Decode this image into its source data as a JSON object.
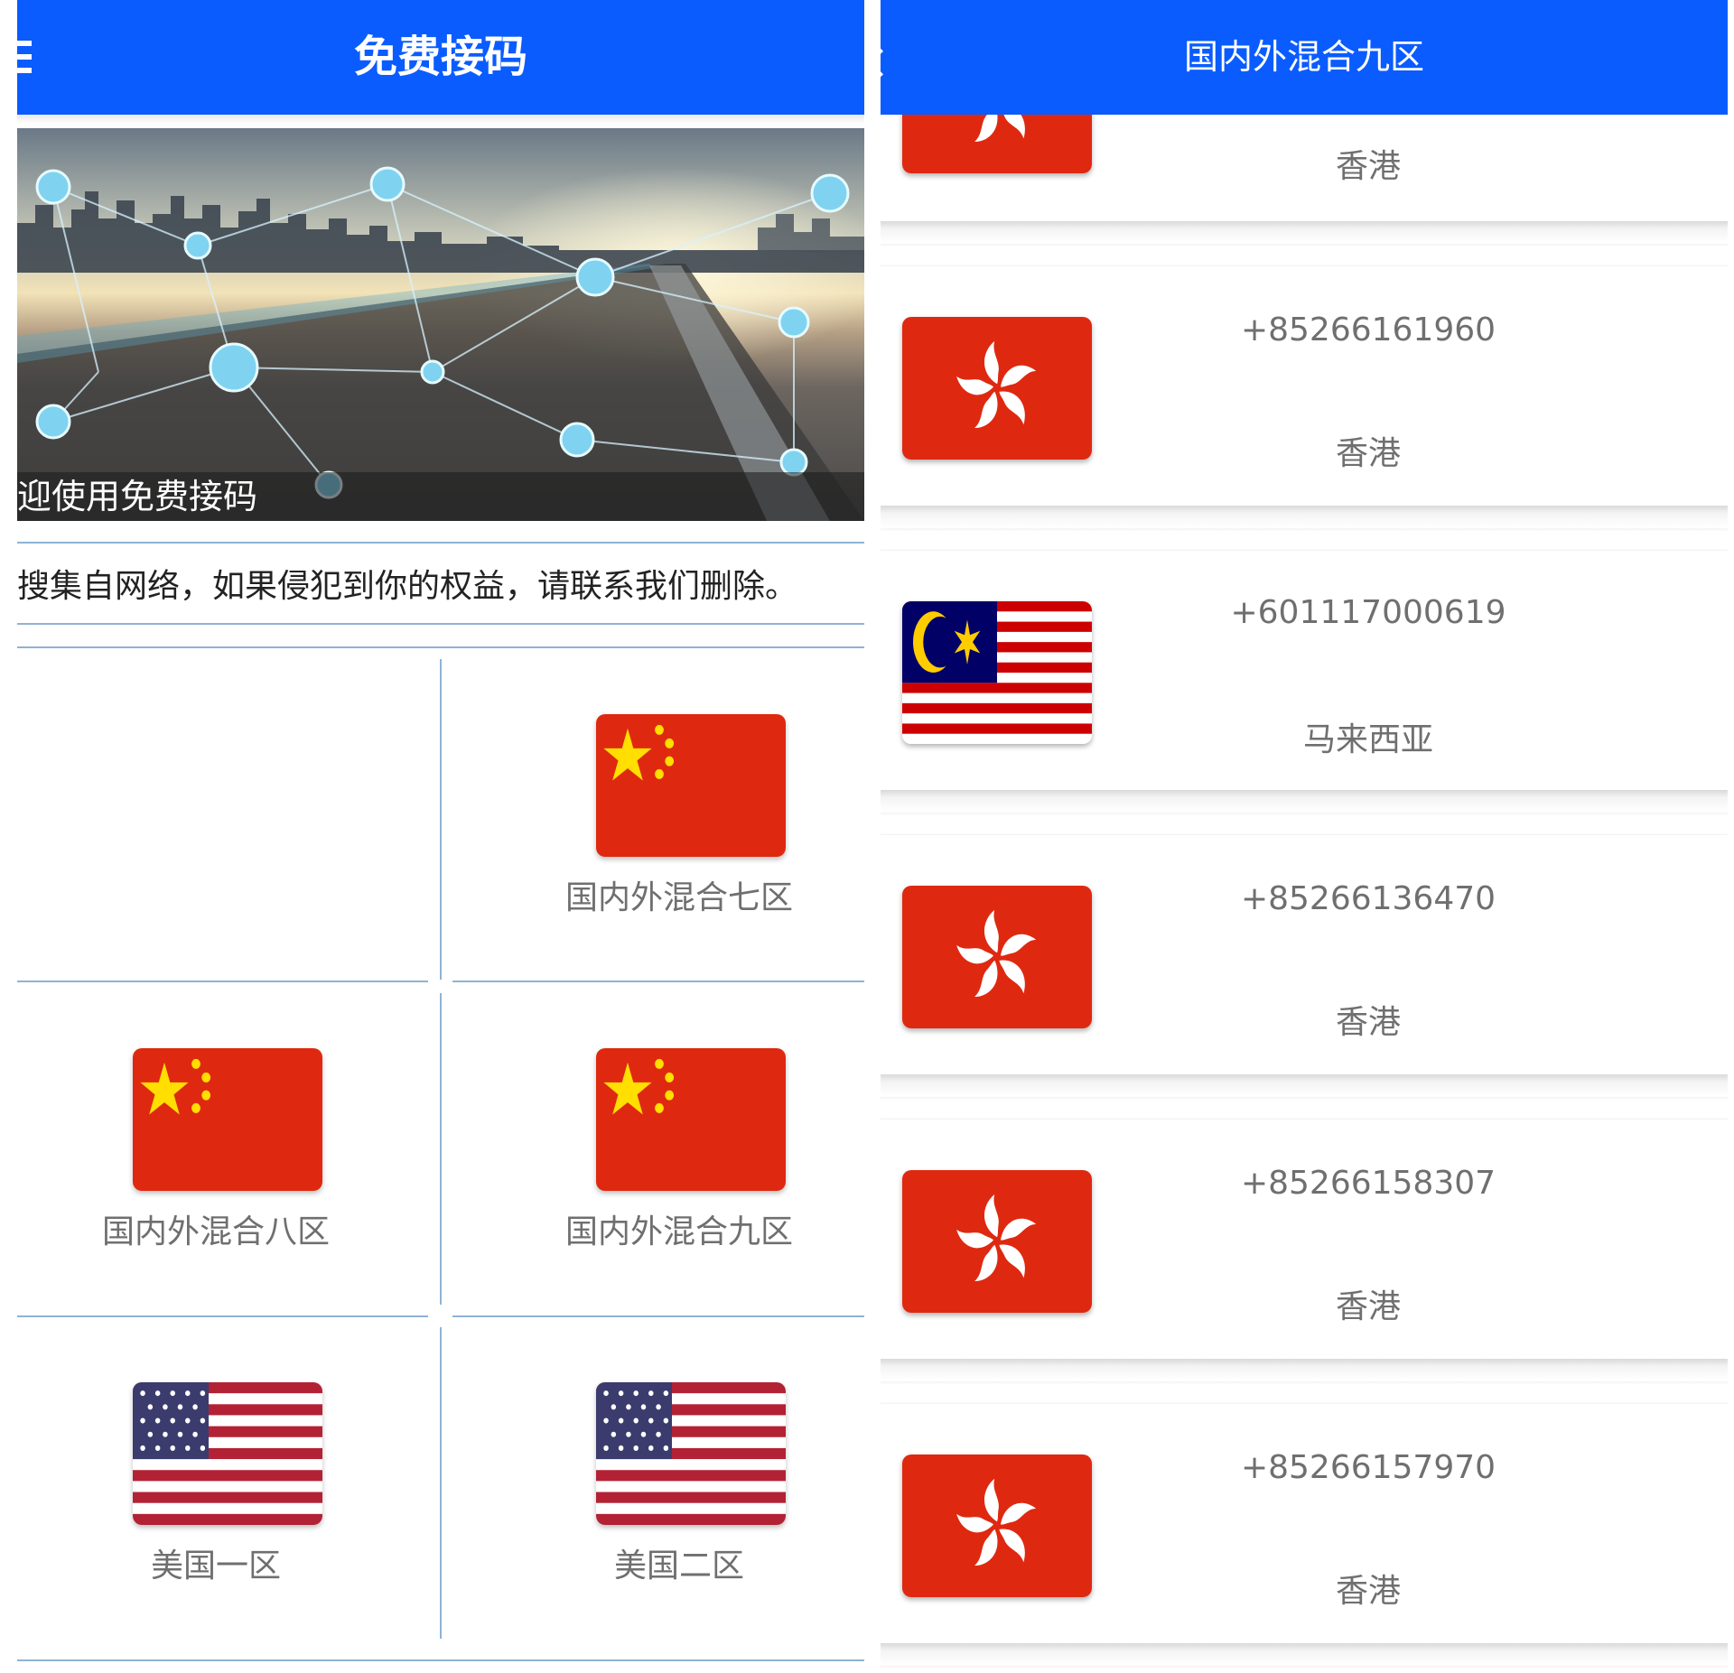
{
  "left_screen": {
    "app_bar": {
      "title": "免费接码",
      "menu_icon": "menu-icon"
    },
    "banner": {
      "caption": "迎使用免费接码"
    },
    "notice": "搜集自网络，如果侵犯到你的权益，请联系我们删除。",
    "grid": [
      {
        "label": "",
        "flag": "empty"
      },
      {
        "label": "国内外混合七区",
        "flag": "china-flag-icon"
      },
      {
        "label": "国内外混合八区",
        "flag": "china-flag-icon"
      },
      {
        "label": "国内外混合九区",
        "flag": "china-flag-icon"
      },
      {
        "label": "美国一区",
        "flag": "usa-flag-icon"
      },
      {
        "label": "美国二区",
        "flag": "usa-flag-icon"
      }
    ]
  },
  "right_screen": {
    "app_bar": {
      "title": "国内外混合九区",
      "back_icon": "back-arrow-icon"
    },
    "numbers": [
      {
        "phone": "",
        "region": "香港",
        "flag": "hong-kong-flag-icon"
      },
      {
        "phone": "+85266161960",
        "region": "香港",
        "flag": "hong-kong-flag-icon"
      },
      {
        "phone": "+601117000619",
        "region": "马来西亚",
        "flag": "malaysia-flag-icon"
      },
      {
        "phone": "+85266136470",
        "region": "香港",
        "flag": "hong-kong-flag-icon"
      },
      {
        "phone": "+85266158307",
        "region": "香港",
        "flag": "hong-kong-flag-icon"
      },
      {
        "phone": "+85266157970",
        "region": "香港",
        "flag": "hong-kong-flag-icon"
      }
    ]
  },
  "colors": {
    "app_bar": "#0a5cff",
    "divider": "#8fb3d5",
    "label_text": "#6f6f6f",
    "flag_red": "#de2910",
    "flag_yellow": "#ffde00"
  }
}
